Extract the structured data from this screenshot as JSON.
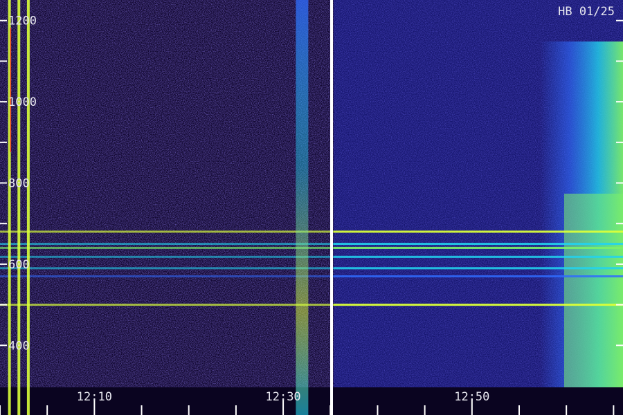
{
  "chart_data": {
    "type": "heatmap",
    "title": "HB 01/25",
    "y_ticks": [
      400,
      600,
      800,
      1000,
      1200
    ],
    "y_minor_ticks": [
      500,
      700,
      900,
      1100
    ],
    "ylim": [
      300,
      1220
    ],
    "x_ticks": [
      "12:10",
      "12:30",
      "12:50"
    ],
    "x_range_min": [
      12.0,
      13.1
    ],
    "grid": false,
    "colors": {
      "background": "#10062e",
      "noise": "#3a2aa8",
      "band_low": "#2f6cff",
      "band_mid": "#22d3ee",
      "band_high": "#7cf06a",
      "band_peak": "#d9ff3a",
      "divider": "#ffffff",
      "marker_red": "#ff3020"
    },
    "horizontal_bands": [
      {
        "y": 680,
        "intensity": 0.85
      },
      {
        "y": 650,
        "intensity": 0.65
      },
      {
        "y": 640,
        "intensity": 0.8
      },
      {
        "y": 618,
        "intensity": 0.55
      },
      {
        "y": 590,
        "intensity": 0.6
      },
      {
        "y": 570,
        "intensity": 0.5
      },
      {
        "y": 500,
        "intensity": 0.9
      }
    ],
    "vertical_events": [
      {
        "time": "12:01",
        "intensity": 0.9
      },
      {
        "time": "12:02",
        "intensity": 0.95
      },
      {
        "time": "12:03",
        "intensity": 0.95
      },
      {
        "time": "12:32",
        "intensity": 0.75
      }
    ],
    "broadband_onset": "12:53"
  }
}
